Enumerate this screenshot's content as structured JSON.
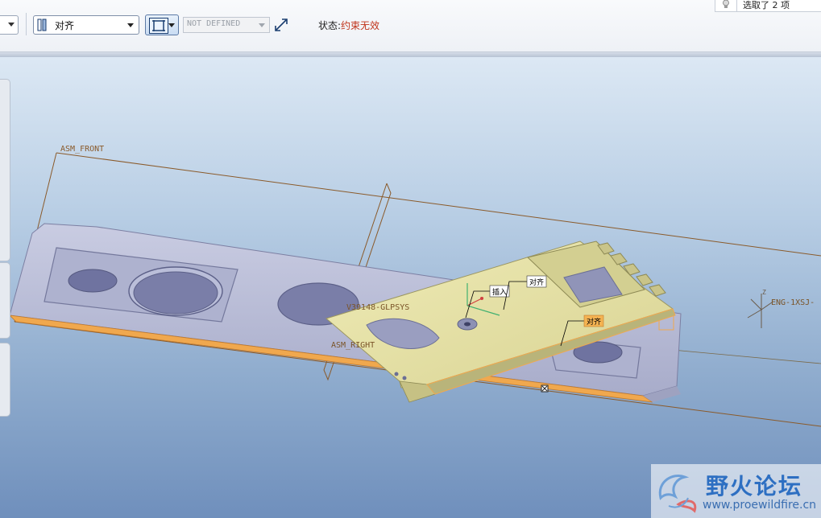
{
  "toolbar": {
    "constraint_type": "对齐",
    "offset_value": "NOT DEFINED",
    "status_label": "状态:",
    "status_value": "约束无效",
    "selection_count": "选取了 2 项"
  },
  "viewport": {
    "datum_labels": {
      "asm_front": "ASM_FRONT",
      "asm_right": "ASM_RIGHT",
      "csys": "V39148-GLPSYS",
      "eng_csys": "ENG-1XSJ-",
      "csys_axis": "Z"
    },
    "constraint_tags": [
      "插入",
      "对齐",
      "对齐"
    ]
  },
  "watermark": {
    "title": "野火论坛",
    "url": "www.proewildfire.cn"
  },
  "colors": {
    "status_value": "#c0331a",
    "datum_line": "#8a5a2a",
    "base_plate": "#b4b8d4",
    "component": "#e4e0a6",
    "highlight_edge": "#f2a64a"
  }
}
